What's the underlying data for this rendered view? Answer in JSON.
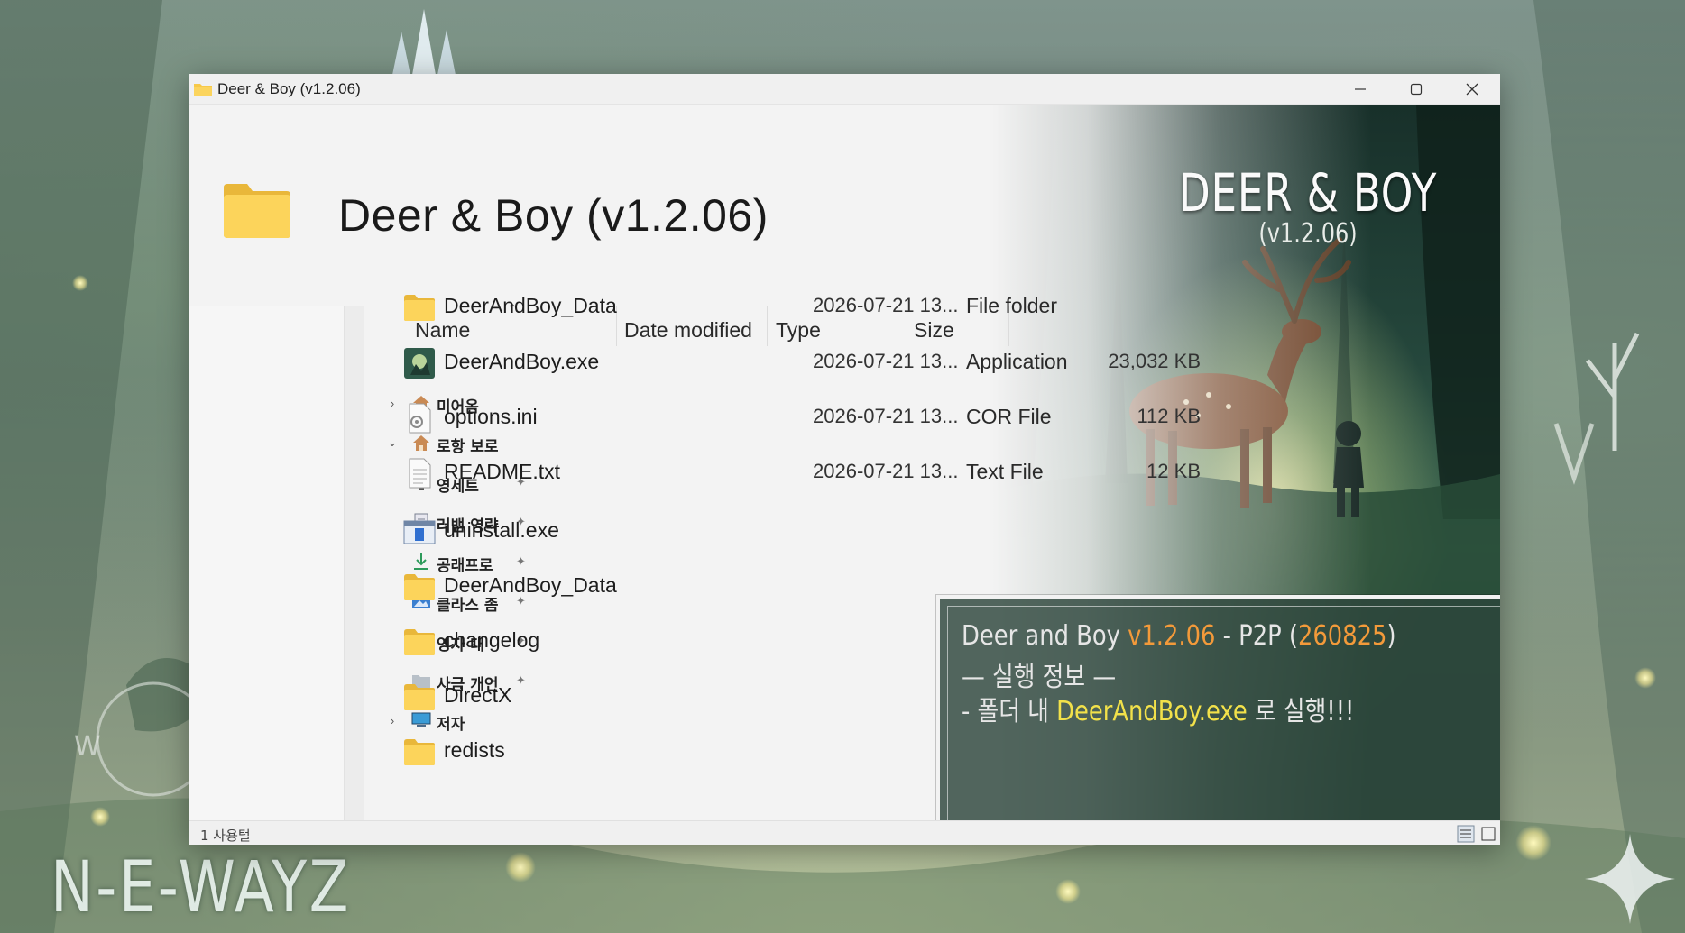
{
  "window": {
    "title": "Deer & Boy (v1.2.06)",
    "header_title": "Deer & Boy (v1.2.06)"
  },
  "artwork": {
    "title": "DEER & BOY",
    "subtitle": "(v1.2.06)"
  },
  "nav": {
    "items": [
      {
        "label": "미어옴",
        "icon": "home-icon",
        "expand": "›",
        "pinned": false
      },
      {
        "label": "로항 보로",
        "icon": "home-icon",
        "expand": "⌄",
        "pinned": false
      },
      {
        "label": "영세트",
        "icon": "desktop-icon",
        "expand": "",
        "pinned": true
      },
      {
        "label": "러뱀 영략",
        "icon": "document-icon",
        "expand": "",
        "pinned": true
      },
      {
        "label": "공래프로",
        "icon": "download-icon",
        "expand": "",
        "pinned": true
      },
      {
        "label": "클라스 좀",
        "icon": "picture-icon",
        "expand": "",
        "pinned": true
      },
      {
        "label": "영자 대",
        "icon": "video-icon",
        "expand": "",
        "pinned": true
      },
      {
        "label": "사금 개언",
        "icon": "folder-icon",
        "expand": "",
        "pinned": true
      },
      {
        "label": "저자",
        "icon": "pc-icon",
        "expand": "›",
        "pinned": false
      }
    ],
    "pin_glyph": "📌"
  },
  "columns": {
    "name": "Name",
    "date": "Date modified",
    "type": "Type",
    "size": "Size"
  },
  "files": [
    {
      "name": "DeerAndBoy_Data",
      "date": "2026-07-21 13...",
      "type": "File folder",
      "size": "",
      "icon": "folder-icon"
    },
    {
      "name": "DeerAndBoy.exe",
      "date": "2026-07-21 13...",
      "type": "Application",
      "size": "23,032 KB",
      "icon": "app-icon"
    },
    {
      "name": "options.ini",
      "date": "2026-07-21 13...",
      "type": "COR File",
      "size": "112 KB",
      "icon": "settings-file-icon"
    },
    {
      "name": "README.txt",
      "date": "2026-07-21 13...",
      "type": "Text File",
      "size": "12 KB",
      "icon": "text-file-icon"
    },
    {
      "name": "uninstall.exe",
      "date": "",
      "type": "",
      "size": "",
      "icon": "installer-icon"
    },
    {
      "name": "DeerAndBoy_Data",
      "date": "",
      "type": "",
      "size": "",
      "icon": "folder-icon"
    },
    {
      "name": "changelog",
      "date": "",
      "type": "",
      "size": "",
      "icon": "folder-icon"
    },
    {
      "name": "DirectX",
      "date": "",
      "type": "",
      "size": "",
      "icon": "folder-icon"
    },
    {
      "name": "redists",
      "date": "",
      "type": "",
      "size": "",
      "icon": "folder-icon"
    }
  ],
  "status": {
    "text": "1 사용털"
  },
  "info": {
    "line1_a": "Deer and Boy ",
    "line1_version": "v1.2.06",
    "line1_b": " - P2P (",
    "line1_code": "260825",
    "line1_c": ")",
    "line2": "— 실행 정보 —",
    "line3_a": "- 폴더 내 ",
    "line3_exe": "DeerAndBoy.exe",
    "line3_b": " 로 실행!!!"
  },
  "watermark": "N-E-WAYZ",
  "colors": {
    "accent_orange": "#f39a3a",
    "accent_yellow": "#f2e14a",
    "folder_yellow": "#f7c948",
    "info_bg": "#2d463c"
  }
}
